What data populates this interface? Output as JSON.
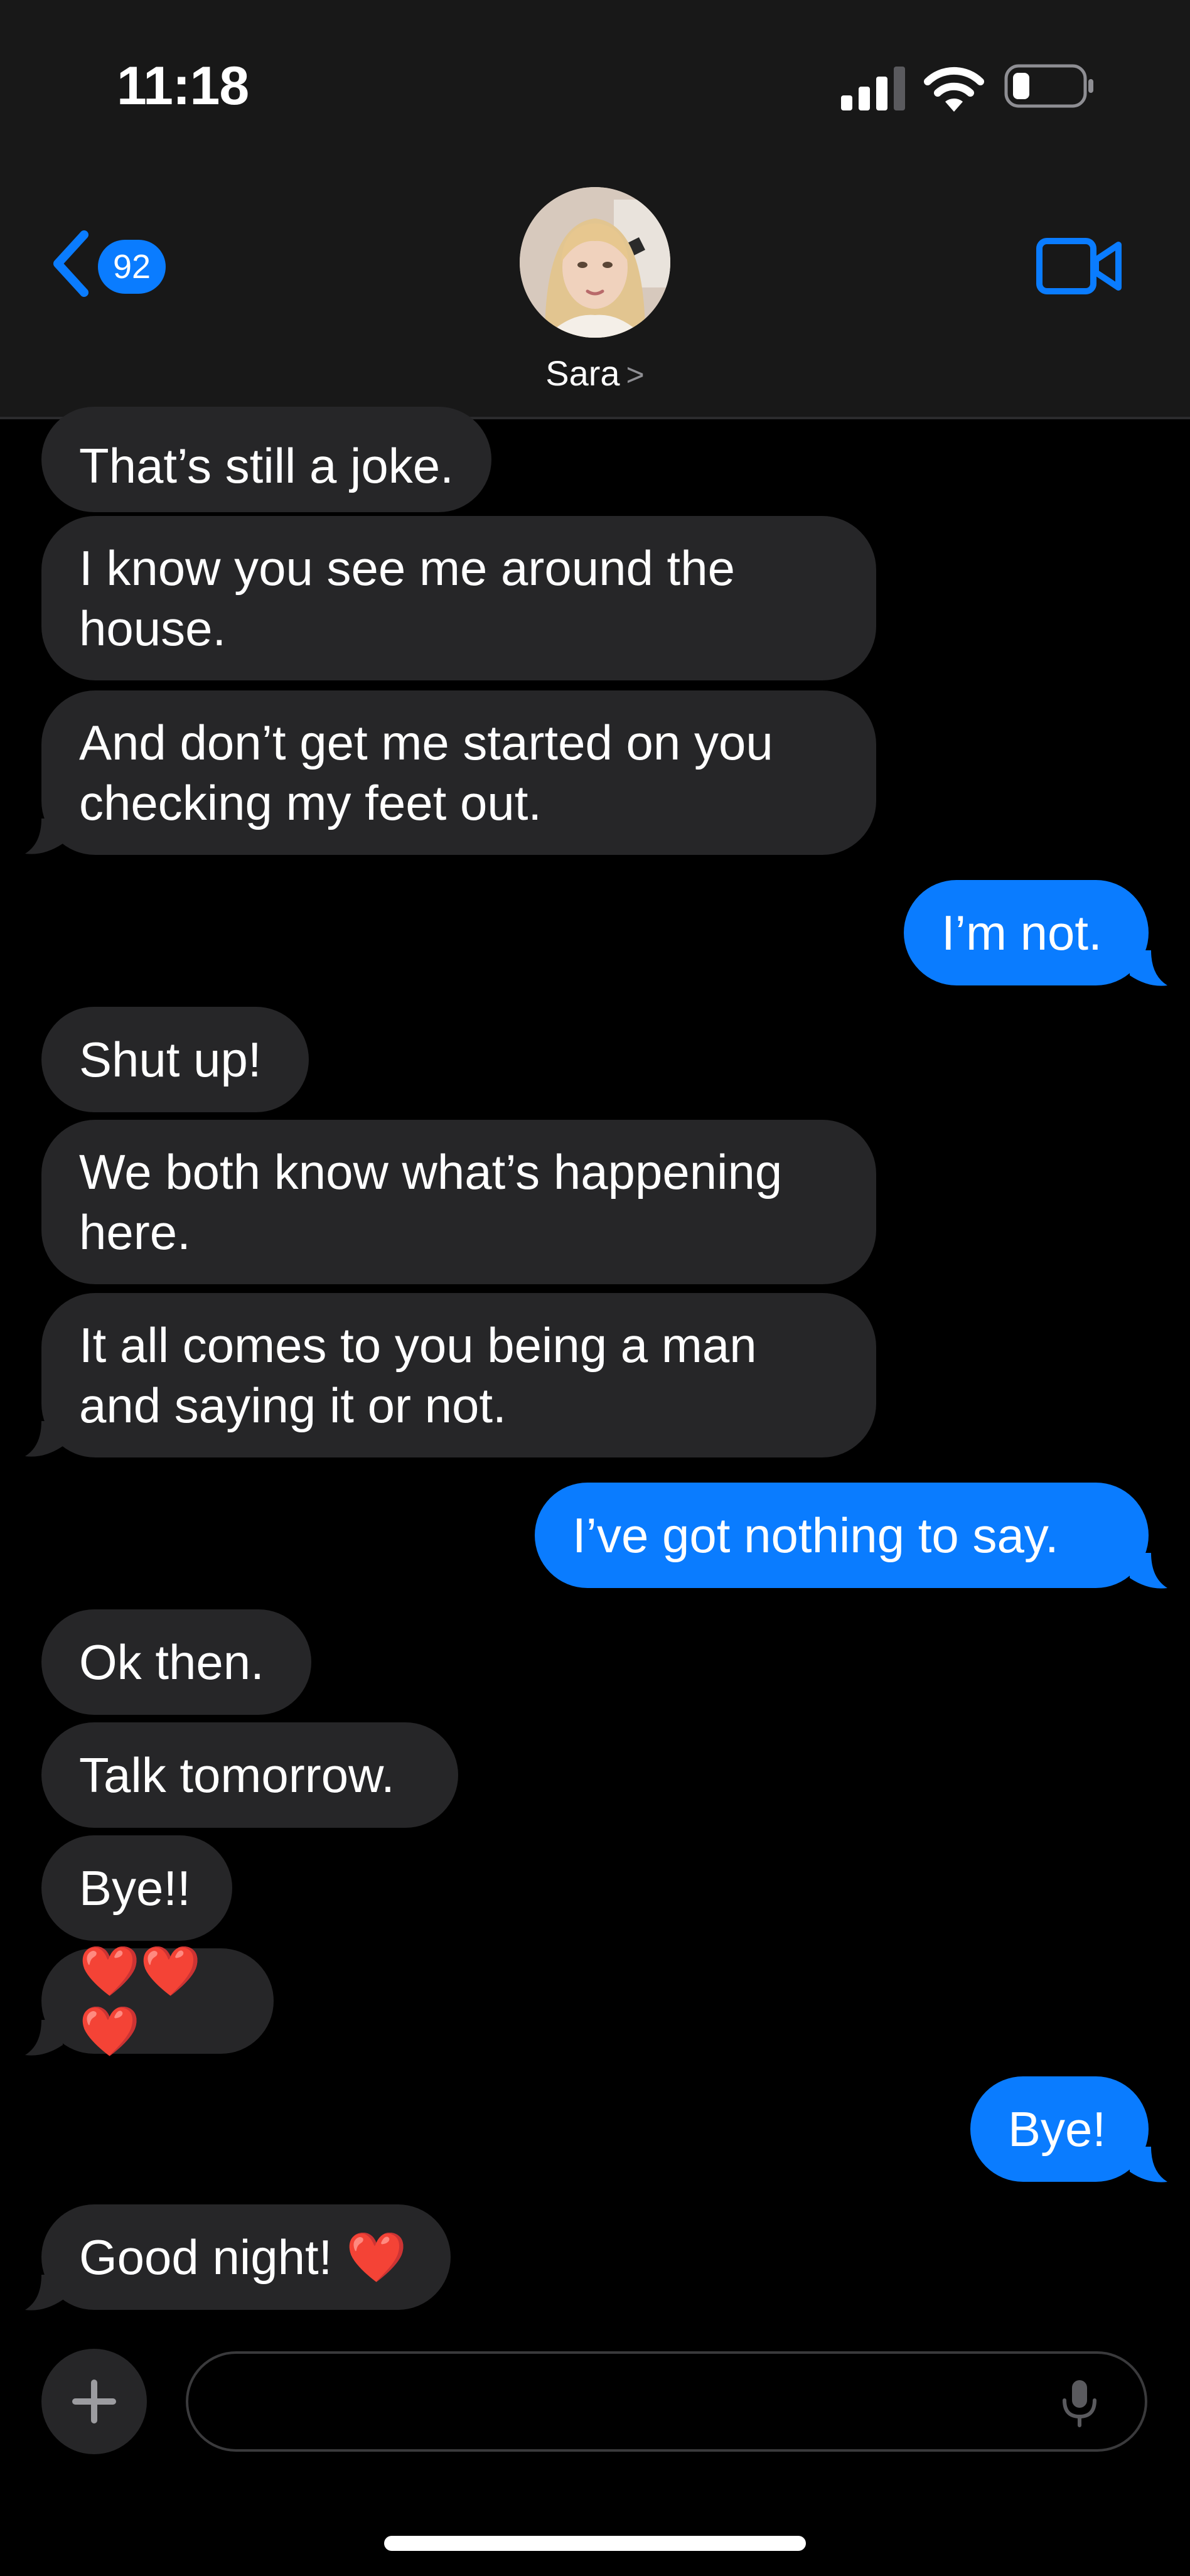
{
  "status_bar": {
    "time": "11:18"
  },
  "header": {
    "back_badge_count": "92",
    "contact_name": "Sara",
    "contact_chevron": ">"
  },
  "icons": {
    "signal": "signal-icon",
    "wifi": "wifi-icon",
    "battery": "battery-icon",
    "back": "chevron-left-icon",
    "video": "video-camera-icon",
    "plus": "plus-icon",
    "mic": "microphone-icon"
  },
  "colors": {
    "accent": "#0a7cff",
    "incoming_bubble": "#262628",
    "header_bg": "#181818",
    "background": "#000000"
  },
  "messages": [
    {
      "from": "them",
      "text": "That’s still a joke."
    },
    {
      "from": "them",
      "text": "I know you see me around the house."
    },
    {
      "from": "them",
      "text": "And don’t get me started on you checking my feet out."
    },
    {
      "from": "me",
      "text": "I’m not."
    },
    {
      "from": "them",
      "text": "Shut up!"
    },
    {
      "from": "them",
      "text": "We both know what’s happening here."
    },
    {
      "from": "them",
      "text": "It all comes to you being a man and saying it or not."
    },
    {
      "from": "me",
      "text": "I’ve got nothing to say."
    },
    {
      "from": "them",
      "text": "Ok then."
    },
    {
      "from": "them",
      "text": "Talk tomorrow."
    },
    {
      "from": "them",
      "text": "Bye!!"
    },
    {
      "from": "them",
      "text": "❤️❤️❤️"
    },
    {
      "from": "me",
      "text": "Bye!"
    },
    {
      "from": "them",
      "text": "Good night! ❤️"
    }
  ],
  "composer": {
    "placeholder": ""
  }
}
